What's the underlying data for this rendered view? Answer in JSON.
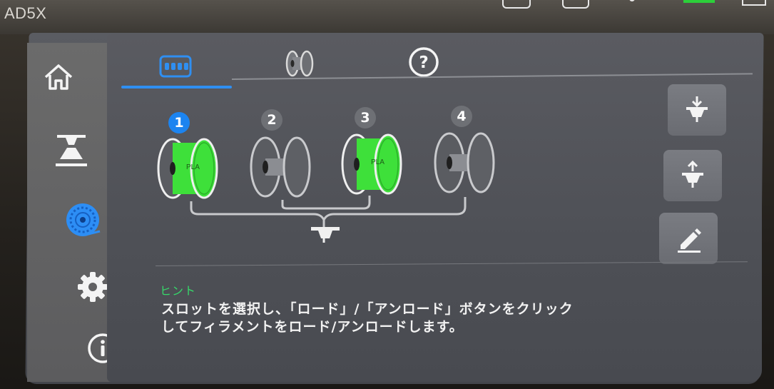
{
  "device": {
    "model": "AD5X"
  },
  "colors": {
    "accent": "#1c84f0",
    "filament": "#3ee03a",
    "hint_title": "#36d86a",
    "panel": "#4e5056"
  },
  "sidebar": {
    "items": [
      {
        "icon": "home-icon"
      },
      {
        "icon": "print-icon"
      },
      {
        "icon": "filament-icon",
        "active": true
      },
      {
        "icon": "gear-icon"
      },
      {
        "icon": "info-icon"
      }
    ]
  },
  "tabs": [
    {
      "icon": "multi-slot-icon",
      "active": true
    },
    {
      "icon": "spool-icon"
    },
    {
      "icon": "help-icon",
      "glyph": "?"
    }
  ],
  "slots": [
    {
      "number": "1",
      "loaded": true,
      "material": "PLA",
      "active": true
    },
    {
      "number": "2",
      "loaded": false
    },
    {
      "number": "3",
      "loaded": true,
      "material": "PLA"
    },
    {
      "number": "4",
      "loaded": false
    }
  ],
  "actions": [
    {
      "icon": "load-icon"
    },
    {
      "icon": "unload-icon"
    },
    {
      "icon": "edit-icon"
    }
  ],
  "hint": {
    "title": "ヒント",
    "line1": "スロットを選択し、「ロード」/「アンロード」ボタンをクリック",
    "line2": "してフィラメントをロード/アンロードします。"
  }
}
